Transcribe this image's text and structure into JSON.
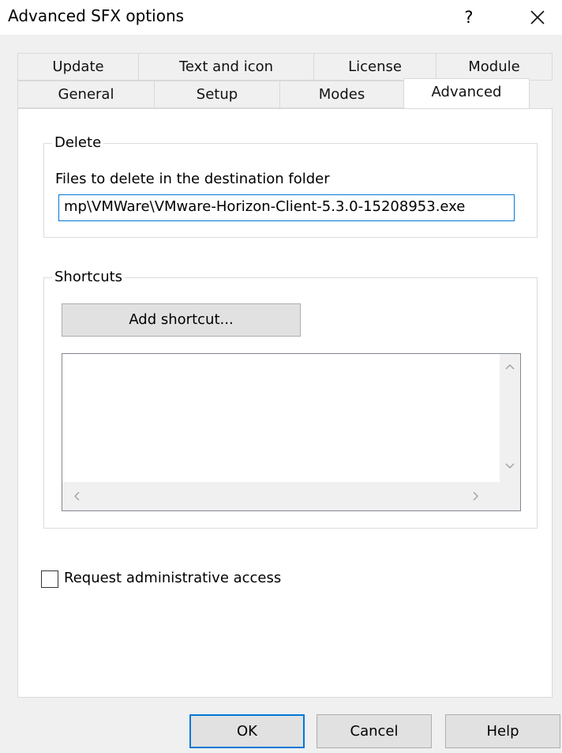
{
  "window": {
    "title": "Advanced SFX options",
    "help_label": "?"
  },
  "tabs": {
    "row1": [
      "Update",
      "Text and icon",
      "License",
      "Module"
    ],
    "row2": [
      "General",
      "Setup",
      "Modes",
      "Advanced"
    ],
    "active": "Advanced"
  },
  "delete_group": {
    "legend": "Delete",
    "files_label": "Files to delete in the destination folder",
    "files_value": "mp\\VMWare\\VMware-Horizon-Client-5.3.0-15208953.exe"
  },
  "shortcuts_group": {
    "legend": "Shortcuts",
    "add_button": "Add shortcut..."
  },
  "admin_checkbox": {
    "label": "Request administrative access",
    "checked": false
  },
  "buttons": {
    "ok": "OK",
    "cancel": "Cancel",
    "help": "Help"
  },
  "colors": {
    "accent": "#0078d7",
    "dialog_bg": "#f0f0f0",
    "panel_bg": "#ffffff"
  }
}
